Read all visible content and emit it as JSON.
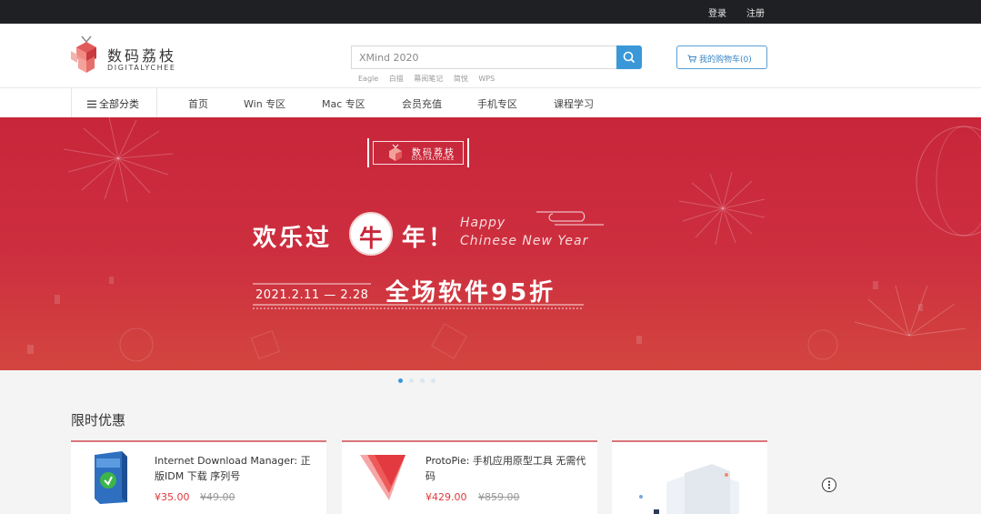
{
  "topbar": {
    "login": "登录",
    "register": "注册"
  },
  "logo": {
    "cn": "数码荔枝",
    "en": "DIGITALYCHEE"
  },
  "search": {
    "placeholder": "XMind 2020",
    "hot": [
      "Eagle",
      "白描",
      "幕阅笔记",
      "简悦",
      "WPS"
    ]
  },
  "cart": {
    "label": "我的购物车(0)"
  },
  "nav": {
    "all": "全部分类",
    "items": [
      "首页",
      "Win 专区",
      "Mac 专区",
      "会员充值",
      "手机专区",
      "课程学习"
    ]
  },
  "banner": {
    "badge_cn": "数码荔枝",
    "badge_en": "DIGITALYCHEE",
    "headline_a": "欢乐过",
    "headline_niu": "牛",
    "headline_b": "年！",
    "happy_line1": "Happy",
    "happy_line2": "Chinese New Year",
    "date": "2021.2.11 — 2.28",
    "sale": "全场软件95折",
    "slide_count": 4,
    "active_slide": 1
  },
  "promo": {
    "title": "限时优惠",
    "items": [
      {
        "title": "Internet Download Manager: 正版IDM 下载 序列号",
        "price": "¥35.00",
        "old_price": "¥49.00",
        "icon": "idm-box-icon"
      },
      {
        "title": "ProtoPie: 手机应用原型工具 无需代码",
        "price": "¥429.00",
        "old_price": "¥859.00",
        "icon": "protopie-icon"
      }
    ]
  },
  "colors": {
    "accent": "#3a98d8",
    "banner": "#c8263a",
    "price": "#e0393b",
    "topbar": "#1f2023"
  }
}
